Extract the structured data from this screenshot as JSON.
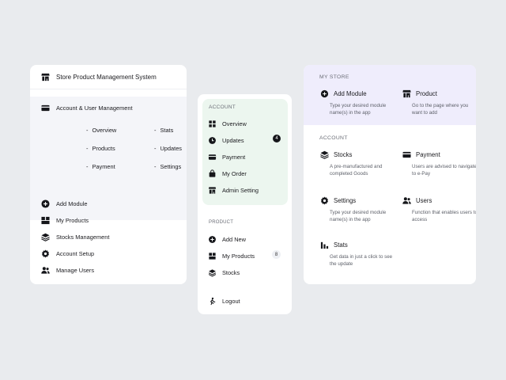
{
  "card1": {
    "title": "Store Product Management System",
    "section": "Account & User Management",
    "sub_left": [
      "Overview",
      "Products",
      "Payment"
    ],
    "sub_right": [
      "Stats",
      "Updates",
      "Settings"
    ],
    "bullet": "-",
    "items": [
      {
        "label": "Add Module",
        "icon": "plus-circle-icon"
      },
      {
        "label": "My Products",
        "icon": "boxes-icon"
      },
      {
        "label": "Stocks Management",
        "icon": "layers-icon"
      },
      {
        "label": "Account Setup",
        "icon": "gear-icon"
      },
      {
        "label": "Manage Users",
        "icon": "users-icon"
      }
    ]
  },
  "card2": {
    "account_header": "ACCOUNT",
    "account_items": [
      {
        "label": "Overview",
        "icon": "grid-icon"
      },
      {
        "label": "Updates",
        "icon": "clock-icon",
        "badge": "4"
      },
      {
        "label": "Payment",
        "icon": "card-icon"
      },
      {
        "label": "My Order",
        "icon": "bag-icon"
      },
      {
        "label": "Admin Setting",
        "icon": "store-icon"
      }
    ],
    "product_header": "PRODUCT",
    "product_items": [
      {
        "label": "Add New",
        "icon": "plus-circle-icon"
      },
      {
        "label": "My Products",
        "icon": "boxes-icon",
        "badge": "8"
      },
      {
        "label": "Stocks",
        "icon": "layers-icon"
      }
    ],
    "logout": "Logout"
  },
  "card3": {
    "store_header": "MY STORE",
    "account_header": "ACCOUNT",
    "tiles": [
      {
        "title": "Add Module",
        "desc": "Type your desired module name(s) in the app",
        "icon": "plus-circle-icon"
      },
      {
        "title": "Product",
        "desc": "Go to the page where you want to add",
        "icon": "store-icon"
      },
      {
        "title": "Stocks",
        "desc": "A pre-manufactured and completed Goods",
        "icon": "layers-icon"
      },
      {
        "title": "Payment",
        "desc": "Users are advised to navigate to e-Pay",
        "icon": "card-icon"
      },
      {
        "title": "Settings",
        "desc": "Type your desired module name(s) in the app",
        "icon": "gear-icon"
      },
      {
        "title": "Users",
        "desc": "Function that enables users to access",
        "icon": "users-icon"
      },
      {
        "title": "Stats",
        "desc": "Get data in just a click to see the update",
        "icon": "bar-chart-icon"
      }
    ]
  },
  "colors": {
    "background": "#e9ebee",
    "card": "#ffffff",
    "card1_section": "#f4f5f9",
    "card2_account": "#ecf6ef",
    "card3_store": "#efedfc"
  }
}
